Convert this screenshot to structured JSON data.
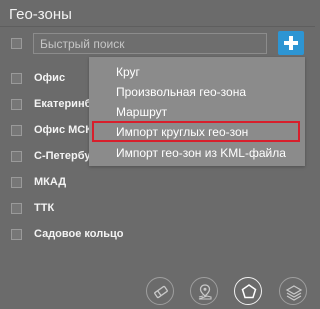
{
  "header": {
    "title": "Гео-зоны"
  },
  "search": {
    "placeholder": "Быстрый поиск"
  },
  "list": {
    "items": [
      {
        "label": "Офис"
      },
      {
        "label": "Екатеринбу"
      },
      {
        "label": "Офис МСК"
      },
      {
        "label": "С-Петербур"
      },
      {
        "label": "МКАД"
      },
      {
        "label": "ТТК"
      },
      {
        "label": "Садовое кольцо"
      }
    ]
  },
  "add_menu": {
    "items": [
      {
        "label": "Круг"
      },
      {
        "label": "Произвольная гео-зона"
      },
      {
        "label": "Маршрут"
      },
      {
        "label": "Импорт круглых гео-зон"
      },
      {
        "label": "Импорт гео-зон из KML-файла"
      }
    ]
  },
  "colors": {
    "accent": "#2d95d3",
    "highlight_border": "#d81f2c",
    "panel": "#6b6b6b",
    "menu": "#8b8b8b"
  },
  "bottom_toolbar": {
    "icons": [
      "eraser-icon",
      "map-marker-icon",
      "polygon-icon",
      "layers-icon"
    ]
  }
}
